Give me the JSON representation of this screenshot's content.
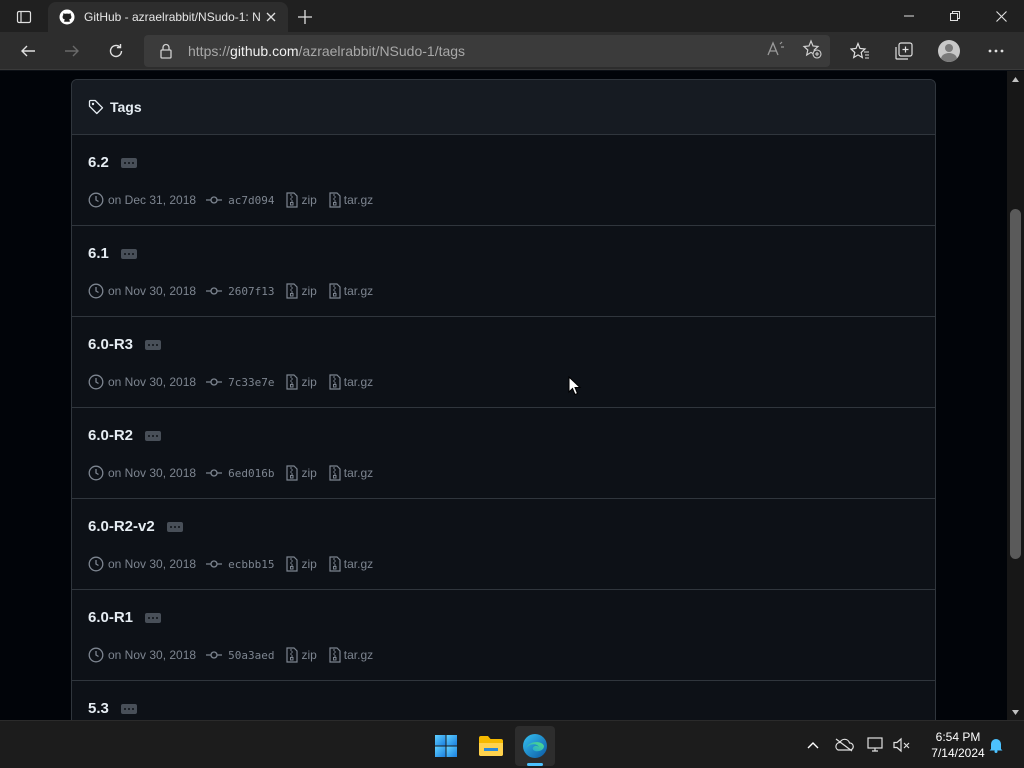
{
  "browser": {
    "tab_title": "GitHub - azraelrabbit/NSudo-1: N",
    "url_prefix": "https://",
    "url_host": "github.com",
    "url_path": "/azraelrabbit/NSudo-1/tags"
  },
  "page": {
    "section_title": "Tags",
    "tags": [
      {
        "name": "6.2",
        "date": "on Dec 31, 2018",
        "sha": "ac7d094",
        "zip": "zip",
        "tar": "tar.gz"
      },
      {
        "name": "6.1",
        "date": "on Nov 30, 2018",
        "sha": "2607f13",
        "zip": "zip",
        "tar": "tar.gz"
      },
      {
        "name": "6.0-R3",
        "date": "on Nov 30, 2018",
        "sha": "7c33e7e",
        "zip": "zip",
        "tar": "tar.gz"
      },
      {
        "name": "6.0-R2",
        "date": "on Nov 30, 2018",
        "sha": "6ed016b",
        "zip": "zip",
        "tar": "tar.gz"
      },
      {
        "name": "6.0-R2-v2",
        "date": "on Nov 30, 2018",
        "sha": "ecbbb15",
        "zip": "zip",
        "tar": "tar.gz"
      },
      {
        "name": "6.0-R1",
        "date": "on Nov 30, 2018",
        "sha": "50a3aed",
        "zip": "zip",
        "tar": "tar.gz"
      },
      {
        "name": "5.3",
        "date": "",
        "sha": "",
        "zip": "",
        "tar": ""
      }
    ]
  },
  "taskbar": {
    "time": "6:54 PM",
    "date": "7/14/2024",
    "apps": [
      "windows-start-icon",
      "file-explorer-icon",
      "edge-icon"
    ]
  },
  "colors": {
    "page_bg": "#010409",
    "box_bg": "#0d1117",
    "border": "#30363d",
    "text_primary": "#e6edf3",
    "text_muted": "#7d8590",
    "accent": "#4cc2ff"
  }
}
